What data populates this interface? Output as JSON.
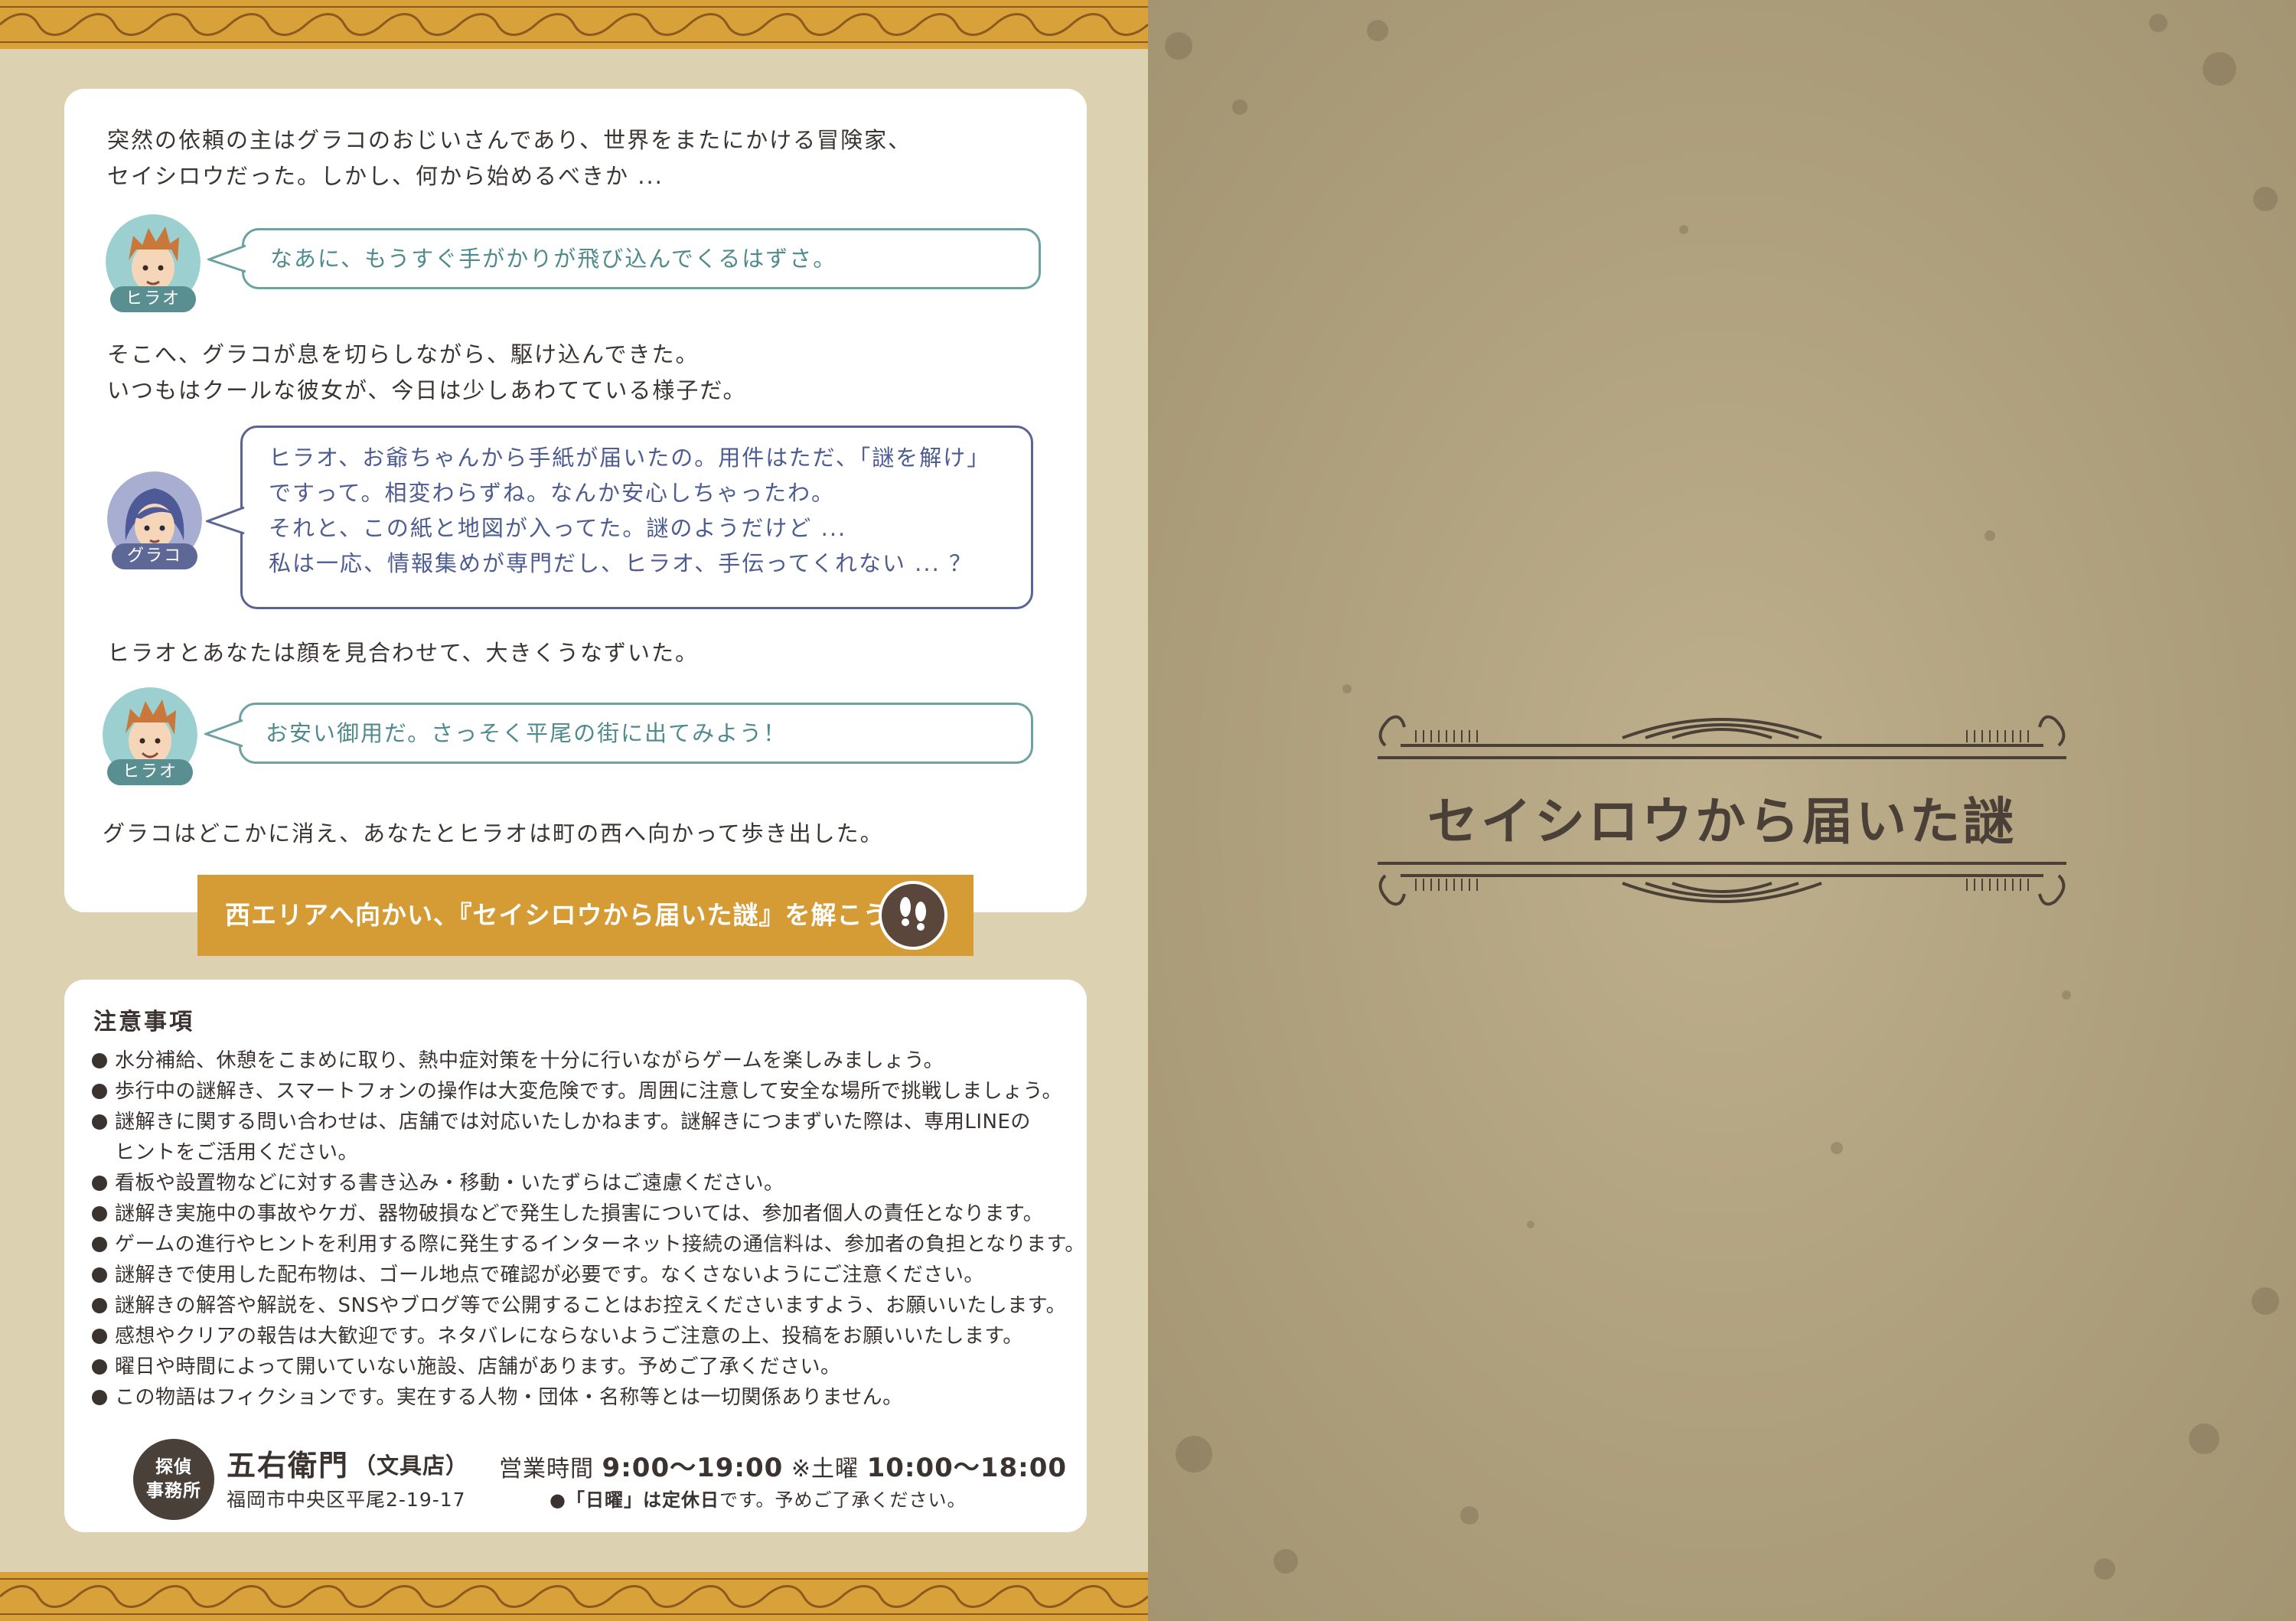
{
  "story": {
    "intro_lines": [
      "突然の依頼の主はグラコのおじいさんであり、世界をまたにかける冒険家、",
      "セイシロウだった。しかし、何から始めるべきか ..."
    ],
    "bubble1": {
      "speaker": "ヒラオ",
      "lines": [
        "なあに、もうすぐ手がかりが飛び込んでくるはずさ。"
      ]
    },
    "narr2_lines": [
      "そこへ、グラコが息を切らしながら、駆け込んできた。",
      "いつもはクールな彼女が、今日は少しあわてている様子だ。"
    ],
    "bubble2": {
      "speaker": "グラコ",
      "lines": [
        "ヒラオ、お爺ちゃんから手紙が届いたの。用件はただ、「謎を解け」",
        "ですって。相変わらずね。なんか安心しちゃったわ。",
        "それと、この紙と地図が入ってた。謎のようだけど ...",
        "私は一応、情報集めが専門だし、ヒラオ、手伝ってくれない ... ？"
      ]
    },
    "narr3": "ヒラオとあなたは顔を見合わせて、大きくうなずいた。",
    "bubble3": {
      "speaker": "ヒラオ",
      "lines": [
        "お安い御用だ。さっそく平尾の街に出てみよう！"
      ]
    },
    "narr4": "グラコはどこかに消え、あなたとヒラオは町の西へ向かって歩き出した。",
    "cta": "西エリアへ向かい、『セイシロウから届いた謎』を解こう！"
  },
  "notes": {
    "title": "注意事項",
    "items": [
      "水分補給、休憩をこまめに取り、熱中症対策を十分に行いながらゲームを楽しみましょう。",
      "歩行中の謎解き、スマートフォンの操作は大変危険です。周囲に注意して安全な場所で挑戦しましょう。",
      "謎解きに関する問い合わせは、店舗では対応いたしかねます。謎解きにつまずいた際は、専用LINEの",
      "看板や設置物などに対する書き込み・移動・いたずらはご遠慮ください。",
      "謎解き実施中の事故やケガ、器物破損などで発生した損害については、参加者個人の責任となります。",
      "ゲームの進行やヒントを利用する際に発生するインターネット接続の通信料は、参加者の負担となります。",
      "謎解きで使用した配布物は、ゴール地点で確認が必要です。なくさないようにご注意ください。",
      "謎解きの解答や解説を、SNSやブログ等で公開することはお控えくださいますよう、お願いいたします。",
      "感想やクリアの報告は大歓迎です。ネタバレにならないようご注意の上、投稿をお願いいたします。",
      "曜日や時間によって開いていない施設、店舗があります。予めご了承ください。",
      "この物語はフィクションです。実在する人物・団体・名称等とは一切関係ありません。"
    ],
    "item3_continuation": "ヒントをご活用ください。"
  },
  "office": {
    "badge_line1": "探偵",
    "badge_line2": "事務所",
    "name": "五右衛門",
    "type": "（文具店）",
    "address": "福岡市中央区平尾2-19-17",
    "hours_label": "営業時間",
    "hours": "9:00〜19:00",
    "saturday_label": "※土曜",
    "saturday_hours": "10:00〜18:00",
    "holiday_prefix": "●「日曜」は定休日",
    "holiday_suffix": "です。予めご了承ください。"
  },
  "cover": {
    "title": "セイシロウから届いた謎"
  },
  "colors": {
    "accent_orange": "#d59b34",
    "teal": "#5a8f92",
    "navy": "#5d6896",
    "paper_left": "#dcd2b2",
    "paper_right": "#b8a986"
  }
}
